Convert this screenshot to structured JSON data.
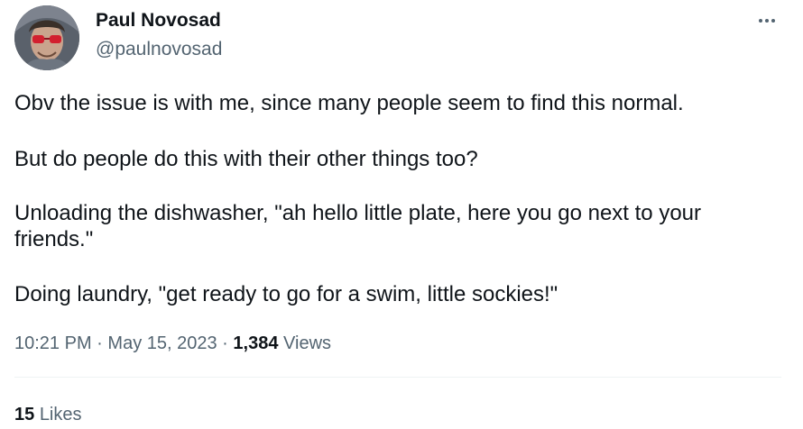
{
  "author": {
    "name": "Paul Novosad",
    "handle": "@paulnovosad"
  },
  "tweet": {
    "paragraphs": [
      "Obv the issue is with me, since many people seem to find this normal.",
      "But do people do this with their other things too?",
      "Unloading the dishwasher, \"ah hello little plate, here you go next to your friends.\"",
      "Doing laundry, \"get ready to go for a swim, little sockies!\""
    ],
    "time": "10:21 PM",
    "date": "May 15, 2023",
    "separator": "·",
    "views_count": "1,384",
    "views_label": "Views",
    "likes_count": "15",
    "likes_label": "Likes"
  },
  "icons": {
    "more": "more-horizontal-icon"
  },
  "colors": {
    "text_primary": "#0f1419",
    "text_secondary": "#536471",
    "divider": "#eff3f4"
  }
}
